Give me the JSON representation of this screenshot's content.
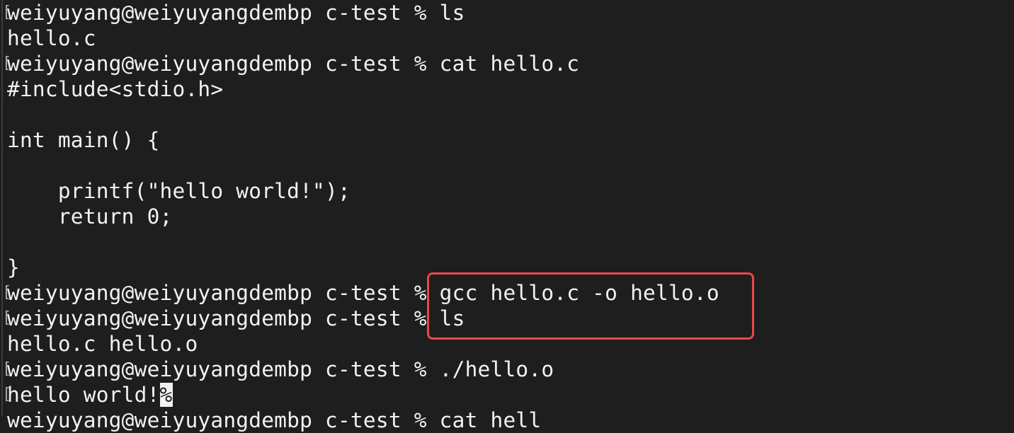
{
  "terminal": {
    "lines": [
      "weiyuyang@weiyuyangdembp c-test % ls",
      "hello.c",
      "weiyuyang@weiyuyangdembp c-test % cat hello.c",
      "#include<stdio.h>",
      "",
      "int main() {",
      "",
      "    printf(\"hello world!\");",
      "    return 0;",
      "",
      "}",
      "weiyuyang@weiyuyangdembp c-test % gcc hello.c -o hello.o",
      "weiyuyang@weiyuyangdembp c-test % ls",
      "hello.c hello.o",
      "weiyuyang@weiyuyangdembp c-test % ./hello.o",
      "hello world!",
      "weiyuyang@weiyuyangdembp c-test % cat hell"
    ],
    "cursor_glyph": "%",
    "line_marker": "[",
    "background": "#1e1e1e",
    "foreground": "#f2f2f2",
    "highlight_color": "#e84848"
  }
}
